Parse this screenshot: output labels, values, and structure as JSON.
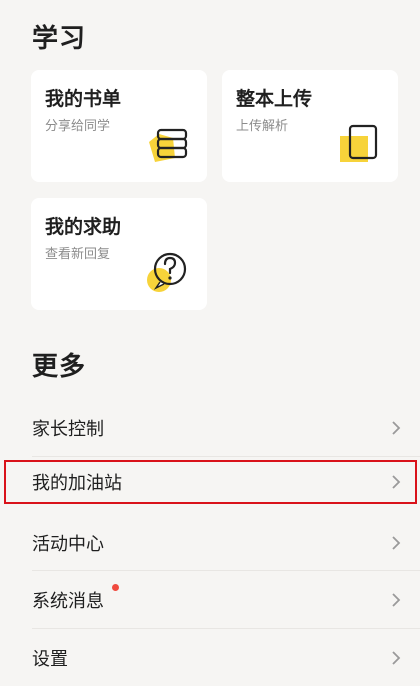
{
  "study": {
    "title": "学习",
    "cards": [
      {
        "title": "我的书单",
        "subtitle": "分享给同学",
        "icon": "book-stack-icon"
      },
      {
        "title": "整本上传",
        "subtitle": "上传解析",
        "icon": "upload-book-icon"
      },
      {
        "title": "我的求助",
        "subtitle": "查看新回复",
        "icon": "help-question-icon"
      }
    ]
  },
  "more": {
    "title": "更多",
    "items": [
      {
        "label": "家长控制"
      },
      {
        "label": "我的加油站"
      },
      {
        "label": "活动中心"
      },
      {
        "label": "系统消息",
        "badge_dot": true
      },
      {
        "label": "设置"
      }
    ]
  },
  "colors": {
    "accent_yellow": "#f7d33a",
    "highlight_red": "#d9121a",
    "badge_red": "#f04a3e",
    "background": "#f6f5f3"
  }
}
